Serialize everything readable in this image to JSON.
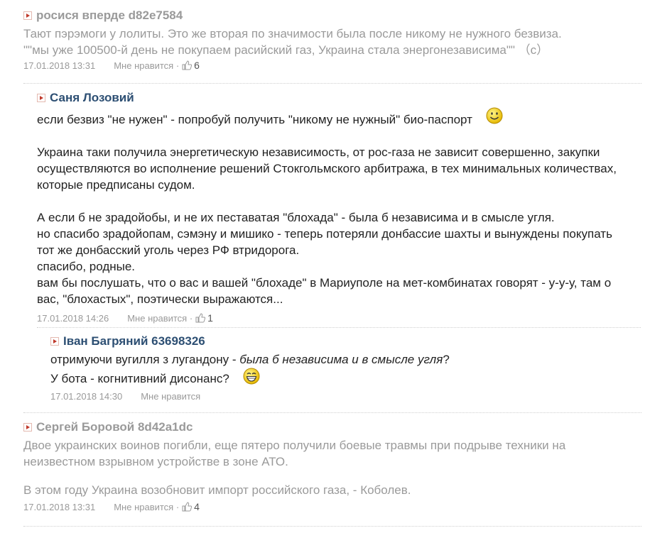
{
  "comments": [
    {
      "author": "росися вперде d82e7584",
      "lines": [
        "Тают пэрэмоги у лолиты. Это же вторая по значимости была после никому не нужного безвиза.",
        "\"\"мы уже 100500-й день не покупаем расийский газ, Украина стала энергонезависима\"\" （с）"
      ],
      "date": "17.01.2018 13:31",
      "like_label": "Мне нравится ·",
      "likes": "6"
    },
    {
      "author": "Саня Лозовий",
      "line1": "если безвиз \"не нужен\" - попробуй получить \"никому не нужный\" био-паспорт",
      "para2": [
        "Украина таки получила энергетическую независимость, от рос-газа не зависит совершенно, закупки",
        "осуществляются во исполнение решений Стокгольмского арбитража, в тех минимальных количествах,",
        "которые предписаны судом."
      ],
      "para3": [
        "А если б не зрадойобы, и не их пеставатая \"блохада\" - была б независима и в смысле угля.",
        "но спасибо зрадойопам, сэмэну и мишико - теперь потеряли донбассие шахты и вынуждены покупать",
        "тот же донбасский уголь через РФ втридорога.",
        "спасибо, родные.",
        "вам бы послушать, что о вас и вашей \"блохаде\" в Мариуполе на мет-комбинатах говорят - у-у-у, там о",
        "вас, \"блохастых\", поэтически выражаются..."
      ],
      "date": "17.01.2018 14:26",
      "like_label": "Мне нравится ·",
      "likes": "1"
    },
    {
      "author": "Іван Багряний 63698326",
      "line1_plain": "отримуючи вугилля з лугандону - ",
      "line1_italic": "была б независима и в смысле угля",
      "line1_end": "?",
      "line2": "У бота - когнитивний дисонанс?",
      "date": "17.01.2018 14:30",
      "like_label": "Мне нравится"
    },
    {
      "author": "Сергей Боровой 8d42a1dc",
      "lines": [
        "Двое украинских воинов погибли, еще пятеро получили боевые травмы при подрыве техники на",
        "неизвестном взрывном устройстве в зоне АТО."
      ],
      "line3": "В этом году Украина возобновит импорт российского газа, - Коболев.",
      "date": "17.01.2018 13:31",
      "like_label": "Мне нравится ·",
      "likes": "4"
    }
  ]
}
